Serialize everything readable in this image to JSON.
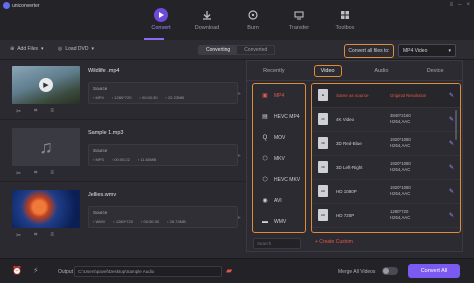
{
  "app": {
    "brand": "uniconverter"
  },
  "nav": {
    "items": [
      {
        "label": "Convert",
        "icon": "convert-icon"
      },
      {
        "label": "Download",
        "icon": "download-icon"
      },
      {
        "label": "Burn",
        "icon": "burn-icon"
      },
      {
        "label": "Transfer",
        "icon": "transfer-icon"
      },
      {
        "label": "Toolbox",
        "icon": "toolbox-icon"
      }
    ],
    "active": "Convert"
  },
  "toolbar": {
    "add_files": "Add Files",
    "load_dvd": "Load DVD",
    "tabs": [
      "Converting",
      "Converted"
    ],
    "convert_all_label": "Convert all files to:",
    "format_value": "MP4 Video"
  },
  "files": [
    {
      "name": "Wildlife .mp4",
      "source_label": "Source",
      "meta": [
        "MP4",
        "1280*720",
        "00:00:30",
        "22.23MB"
      ]
    },
    {
      "name": "Sample 1.mp3",
      "source_label": "Source",
      "meta": [
        "MP3",
        "",
        "00:00:22",
        "11.60MB"
      ]
    },
    {
      "name": "Jellies.wmv",
      "source_label": "Source",
      "meta": [
        "WMV",
        "1280*720",
        "00:00:30",
        "26.73MB"
      ]
    }
  ],
  "panel": {
    "tabs": [
      "Recently",
      "Video",
      "Audio",
      "Device"
    ],
    "active_tab": "Video",
    "formats": [
      "MP4",
      "HEVC MP4",
      "MOV",
      "MKV",
      "HEVC MKV",
      "AVI",
      "WMV"
    ],
    "selected_format": "MP4",
    "resolutions": [
      {
        "name": "Same as source",
        "info1": "Original Resolution",
        "info2": ""
      },
      {
        "name": "4K Video",
        "info1": "3840*2160",
        "info2": "H264,AAC"
      },
      {
        "name": "3D Red-Blue",
        "info1": "1920*1080",
        "info2": "H264,AAC"
      },
      {
        "name": "3D Left-Right",
        "info1": "1920*1080",
        "info2": "H264,AAC"
      },
      {
        "name": "HD 1080P",
        "info1": "1920*1080",
        "info2": "H264,AAC"
      },
      {
        "name": "HD 720P",
        "info1": "1280*720",
        "info2": "H264,AAC"
      }
    ],
    "search_placeholder": "Search",
    "create_custom": "+ Create Custom"
  },
  "bottom": {
    "output_label": "Output",
    "output_path": "C:\\Users\\pavel\\Desktop\\Sample Audio",
    "merge_label": "Merge All Videos",
    "convert_all_button": "Convert All"
  }
}
